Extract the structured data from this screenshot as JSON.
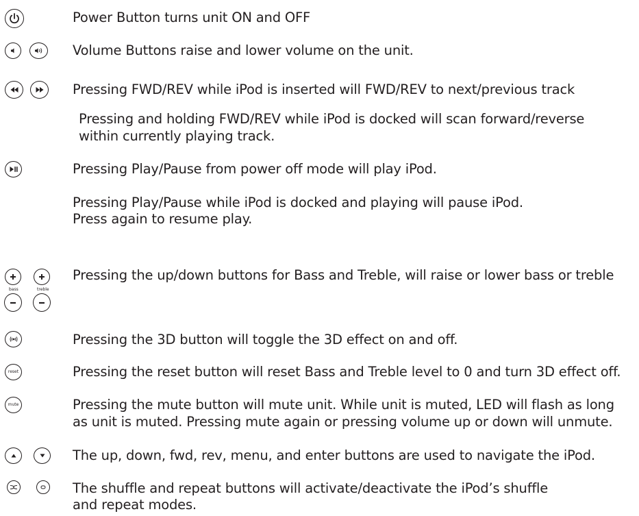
{
  "rows": {
    "power": "Power Button turns unit ON and OFF",
    "volume": "Volume Buttons raise and lower volume on the unit.",
    "skip": "Pressing FWD/REV while iPod is inserted will FWD/REV to next/previous track",
    "scan_line1": "Pressing and holding FWD/REV while iPod is  docked will scan forward/reverse",
    "scan_line2": "within currently playing track.",
    "play": "Pressing Play/Pause from power off mode will play iPod.",
    "pause_line1": "Pressing Play/Pause while iPod is docked and playing will pause iPod.",
    "pause_line2": "Press again to resume play.",
    "bass_treble": "Pressing the up/down buttons for Bass and Treble, will raise or lower bass or treble",
    "threed": "Pressing the 3D button will toggle the 3D effect on  and off.",
    "reset": "Pressing the reset button will reset Bass and Treble level to 0 and turn 3D effect off.",
    "mute_line1": "Pressing the mute button will mute unit. While unit is muted, LED will flash as long",
    "mute_line2": "as unit is muted. Pressing mute again or pressing volume up or down will unmute.",
    "nav": "The up, down, fwd, rev, menu, and enter buttons are used to navigate the iPod.",
    "shuffle_line1": "The shuffle and  repeat buttons will activate/deactivate the iPod’s shuffle",
    "shuffle_line2": "and repeat modes."
  },
  "icon_labels": {
    "bass": "bass",
    "treble": "treble",
    "reset": "reset",
    "mute": "mute"
  }
}
